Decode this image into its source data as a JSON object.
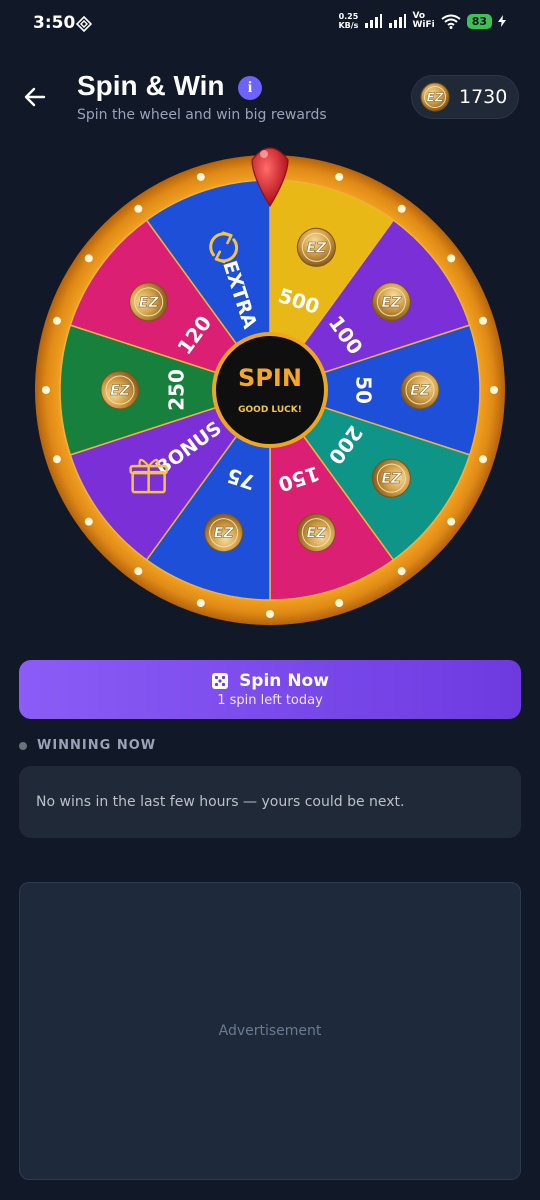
{
  "status": {
    "time": "3:50",
    "net_speed_value": "0.25",
    "net_speed_unit": "KB/s",
    "volte_top": "Vo",
    "volte_bottom": "WiFi",
    "battery": "83"
  },
  "header": {
    "title": "Spin & Win",
    "subtitle": "Spin the wheel and win big rewards",
    "coins": "1730",
    "coin_logo": "EZ"
  },
  "wheel": {
    "center_title": "SPIN",
    "center_sub": "GOOD LUCK!",
    "segments": [
      {
        "label": "500",
        "kind": "coin",
        "color": "#e8b817"
      },
      {
        "label": "100",
        "kind": "coin",
        "color": "#7b2fd6"
      },
      {
        "label": "50",
        "kind": "coin",
        "color": "#1d4fd8"
      },
      {
        "label": "200",
        "kind": "coin",
        "color": "#0f9488"
      },
      {
        "label": "150",
        "kind": "coin",
        "color": "#db1f73"
      },
      {
        "label": "75",
        "kind": "coin",
        "color": "#1d4fd8"
      },
      {
        "label": "BONUS",
        "kind": "gift",
        "color": "#7b2fd6"
      },
      {
        "label": "250",
        "kind": "coin",
        "color": "#17803c"
      },
      {
        "label": "120",
        "kind": "coin",
        "color": "#db1f73"
      },
      {
        "label": "EXTRA",
        "kind": "refresh",
        "color": "#1d4fd8"
      }
    ]
  },
  "spin_button": {
    "label": "Spin Now",
    "sub": "1 spin left today"
  },
  "winning": {
    "heading": "WINNING NOW",
    "empty_text": "No wins in the last few hours — yours could be next."
  },
  "ad": {
    "label": "Advertisement"
  }
}
